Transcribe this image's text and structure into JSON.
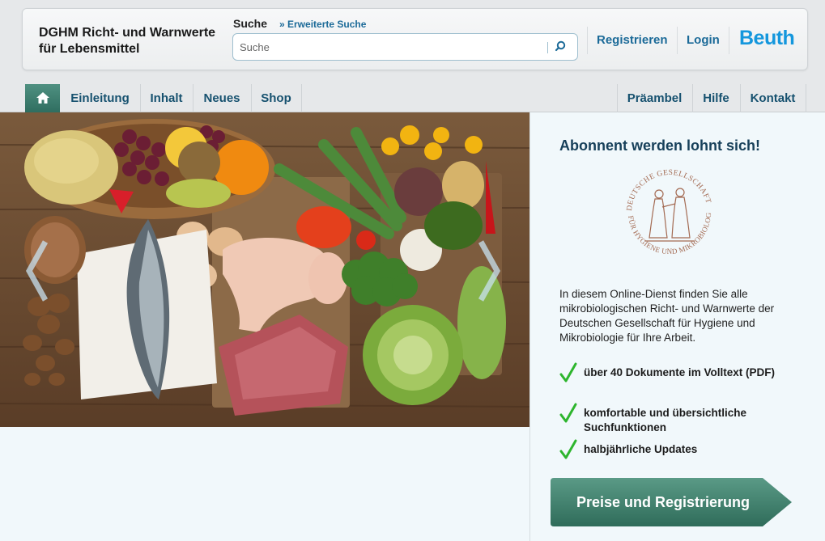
{
  "header": {
    "site_title_line1": "DGHM Richt- und Warnwerte",
    "site_title_line2": "für Lebensmittel",
    "search_label": "Suche",
    "advanced_search": "» Erweiterte Suche",
    "search_placeholder": "Suche",
    "register": "Registrieren",
    "login": "Login",
    "brand": "Beuth"
  },
  "nav": {
    "left": [
      "Einleitung",
      "Inhalt",
      "Neues",
      "Shop"
    ],
    "right": [
      "Präambel",
      "Hilfe",
      "Kontakt"
    ]
  },
  "panel": {
    "title": "Abonnent werden lohnt sich!",
    "seal_text": "DEUTSCHE GESELLSCHAFT FÜR HYGIENE UND MIKROBIOLOGIE E.V.",
    "intro": "In diesem Online-Dienst finden Sie alle mikrobiologischen Richt- und Warnwerte der Deutschen Gesellschaft für Hygiene und Mikrobiologie für Ihre Arbeit.",
    "features": [
      "über 40 Dokumente im Volltext (PDF)",
      "komfortable und übersichtliche Suchfunktionen",
      "halbjährliche Updates"
    ],
    "cta": "Preise und Registrierung"
  },
  "colors": {
    "link": "#1b6a98",
    "brand": "#1497dd",
    "nav_home": "#2f6e60",
    "cta": "#3a7a68",
    "tick": "#2db52d"
  }
}
